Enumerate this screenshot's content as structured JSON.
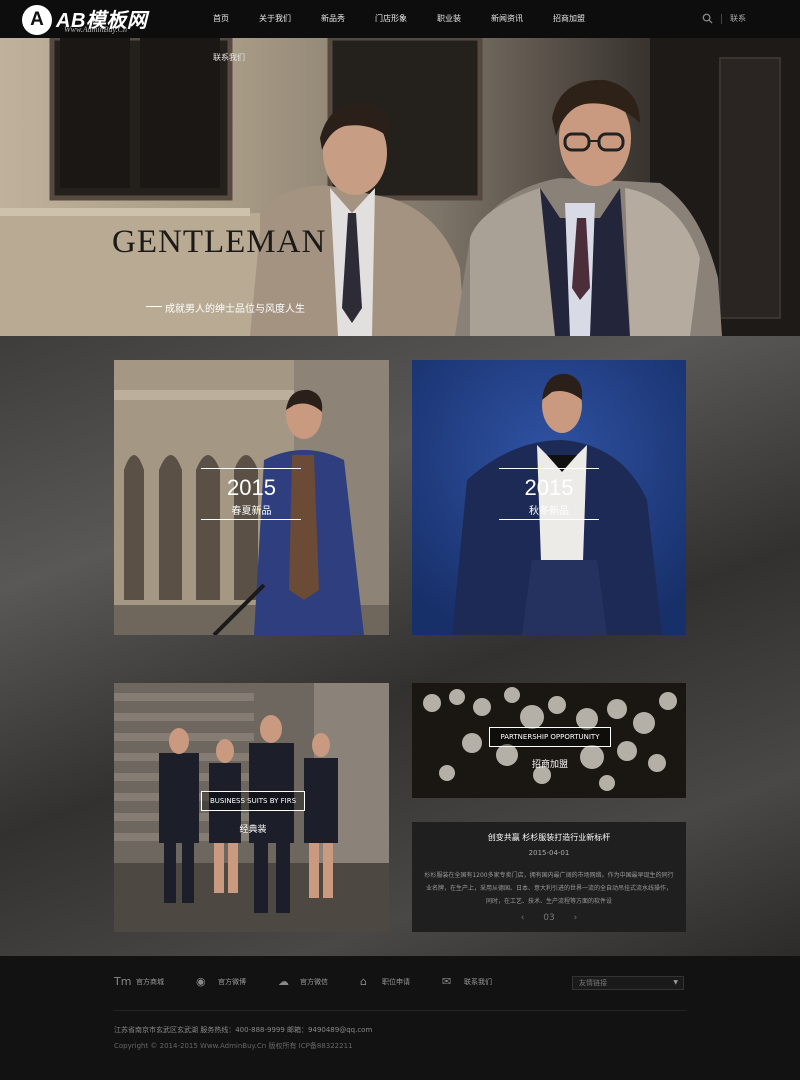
{
  "header": {
    "logo_badge": "A",
    "logo_text": "AB模板网",
    "logo_sub": "Www.AdminBuy.Cn",
    "nav": [
      {
        "label": "首页",
        "name": "nav-home"
      },
      {
        "label": "关于我们",
        "name": "nav-about"
      },
      {
        "label": "新品秀",
        "name": "nav-new-products"
      },
      {
        "label": "门店形象",
        "name": "nav-stores"
      },
      {
        "label": "职业装",
        "name": "nav-workwear"
      },
      {
        "label": "新闻资讯",
        "name": "nav-news"
      },
      {
        "label": "招商加盟",
        "name": "nav-franchise"
      }
    ],
    "nav_sub_label": "联系我们",
    "right_link": "联系"
  },
  "banner": {
    "title": "GENTLEMAN",
    "subtitle": "成就男人的绅士品位与风度人生",
    "slides": 2,
    "active_slide": 1
  },
  "cards": {
    "spring": {
      "year": "2015",
      "name": "春夏新品"
    },
    "autumn": {
      "year": "2015",
      "name": "秋冬新品"
    },
    "suits": {
      "en": "BUSINESS SUITS BY FIRS",
      "cn": "经典装"
    },
    "partner": {
      "en": "PARTNERSHIP OPPORTUNITY",
      "cn": "招商加盟"
    }
  },
  "news": {
    "title": "创变共赢 杉杉服装打造行业新标杆",
    "date": "2015-04-01",
    "body": "杉杉服装在全国有1200多家专卖门店，拥有国内最广阔的市场网络。作为中国最早诞生的同行业名牌，在生产上，采用从德国、日本、意大利引进的世界一流的全自动吊挂式流水线操作，同时，在工艺、技术、生产流程等方面的软件设",
    "prev": "‹",
    "page": "03",
    "next": "›"
  },
  "footer": {
    "links": [
      {
        "icon": "tmall-icon",
        "glyph": "Tm",
        "label": "官方商城"
      },
      {
        "icon": "weibo-icon",
        "glyph": "◉",
        "label": "官方微博"
      },
      {
        "icon": "wechat-icon",
        "glyph": "☁",
        "label": "官方微信"
      },
      {
        "icon": "store-icon",
        "glyph": "⌂",
        "label": "职位申请"
      },
      {
        "icon": "contact-icon",
        "glyph": "✉",
        "label": "联系我们"
      }
    ],
    "select_placeholder": "友情链接",
    "info": "江苏省南京市玄武区玄武湖    服务热线：400-888-9999    邮箱：9490489@qq.com",
    "copyright": "Copyright © 2014-2015 Www.AdminBuy.Cn 版权所有    ICP备88322211"
  }
}
